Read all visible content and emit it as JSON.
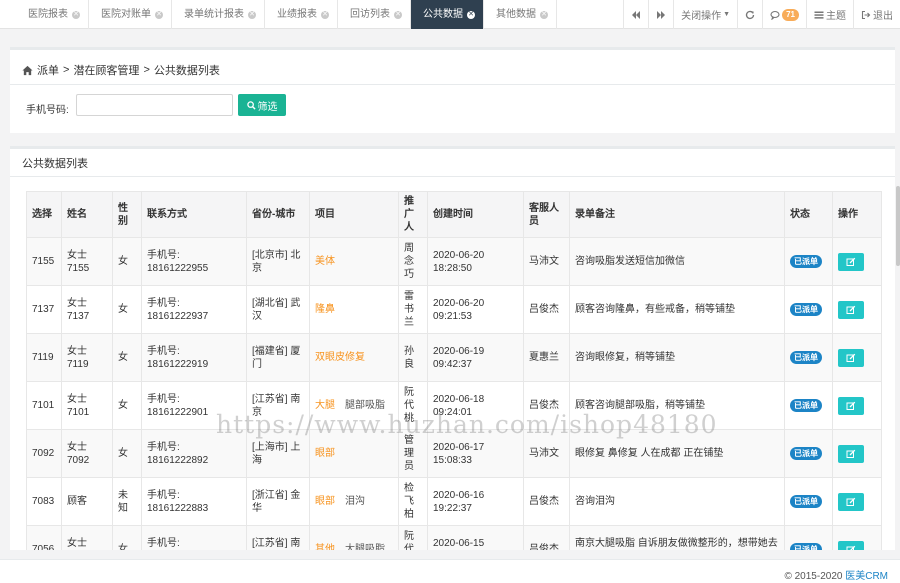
{
  "tabs": [
    {
      "label": "医院报表",
      "active": false
    },
    {
      "label": "医院对账单",
      "active": false
    },
    {
      "label": "录单统计报表",
      "active": false
    },
    {
      "label": "业绩报表",
      "active": false
    },
    {
      "label": "回访列表",
      "active": false
    },
    {
      "label": "公共数据",
      "active": true
    },
    {
      "label": "其他数据",
      "active": false
    }
  ],
  "tools": {
    "close_ops": "关闭操作",
    "message_count": "71",
    "theme": "主题",
    "logout": "退出"
  },
  "breadcrumb": {
    "root": "派单",
    "sep1": ">",
    "level2": "潜在顾客管理",
    "sep2": ">",
    "current": "公共数据列表"
  },
  "filter": {
    "label": "手机号码:",
    "value": "",
    "button": "筛选"
  },
  "list_title": "公共数据列表",
  "columns": [
    "选择",
    "姓名",
    "性别",
    "联系方式",
    "省份-城市",
    "项目",
    "推广人",
    "创建时间",
    "客服人员",
    "录单备注",
    "状态",
    "操作"
  ],
  "rows": [
    {
      "id": "7155",
      "name": "女士7155",
      "gender": "女",
      "phone_label": "手机号:",
      "phone": "18161222955",
      "region": "[北京市] 北京",
      "project1": "美体",
      "project2": "",
      "promoter": "周念巧",
      "date": "2020-06-20",
      "time": "18:28:50",
      "agent": "马沛文",
      "note": "咨询吸脂发送短信加微信",
      "status": "已派单"
    },
    {
      "id": "7137",
      "name": "女士7137",
      "gender": "女",
      "phone_label": "手机号:",
      "phone": "18161222937",
      "region": "[湖北省] 武汉",
      "project1": "隆鼻",
      "project2": "",
      "promoter": "雷书兰",
      "date": "2020-06-20",
      "time": "09:21:53",
      "agent": "吕俊杰",
      "note": "顾客咨询隆鼻，有些戒备，稍等铺垫",
      "status": "已派单"
    },
    {
      "id": "7119",
      "name": "女士7119",
      "gender": "女",
      "phone_label": "手机号:",
      "phone": "18161222919",
      "region": "[福建省] 厦门",
      "project1": "双眼皮修复",
      "project2": "",
      "promoter": "孙良",
      "date": "2020-06-19",
      "time": "09:42:37",
      "agent": "夏惠兰",
      "note": "咨询眼修复，稍等铺垫",
      "status": "已派单"
    },
    {
      "id": "7101",
      "name": "女士7101",
      "gender": "女",
      "phone_label": "手机号:",
      "phone": "18161222901",
      "region": "[江苏省] 南京",
      "project1": "大腿",
      "project2": "腿部吸脂",
      "promoter": "阮代桃",
      "date": "2020-06-18",
      "time": "09:24:01",
      "agent": "吕俊杰",
      "note": "顾客咨询腿部吸脂，稍等铺垫",
      "status": "已派单"
    },
    {
      "id": "7092",
      "name": "女士7092",
      "gender": "女",
      "phone_label": "手机号:",
      "phone": "18161222892",
      "region": "[上海市] 上海",
      "project1": "眼部",
      "project2": "",
      "promoter": "管理员",
      "date": "2020-06-17",
      "time": "15:08:33",
      "agent": "马沛文",
      "note": "眼修复 鼻修复 人在成都 正在铺垫",
      "status": "已派单"
    },
    {
      "id": "7083",
      "name": "顾客",
      "gender": "未知",
      "phone_label": "手机号:",
      "phone": "18161222883",
      "region": "[浙江省] 金华",
      "project1": "眼部",
      "project2": "泪沟",
      "promoter": "检飞柏",
      "date": "2020-06-16",
      "time": "19:22:37",
      "agent": "吕俊杰",
      "note": "咨询泪沟",
      "status": "已派单"
    },
    {
      "id": "7056",
      "name": "女士7056",
      "gender": "女",
      "phone_label": "手机号:",
      "phone": "18161222856",
      "region": "[江苏省] 南京",
      "project1": "其他",
      "project2": "大腿吸脂",
      "promoter": "阮代桃",
      "date": "2020-06-15",
      "time": "11:26:39",
      "agent": "吕俊杰",
      "note": "南京大腿吸脂 自诉朋友做微整形的，想带她去医",
      "status": "已派单"
    }
  ],
  "footer": {
    "copyright": "© 2015-2020 ",
    "brand": "医美CRM"
  },
  "watermark": "https://www.huzhan.com/ishop48180",
  "colors": {
    "accent_green": "#1ab394",
    "status_blue": "#1c84c6",
    "op_cyan": "#23c6c8",
    "project_orange": "#f7931e",
    "active_tab": "#2f4050",
    "badge_orange": "#f8ac59"
  }
}
